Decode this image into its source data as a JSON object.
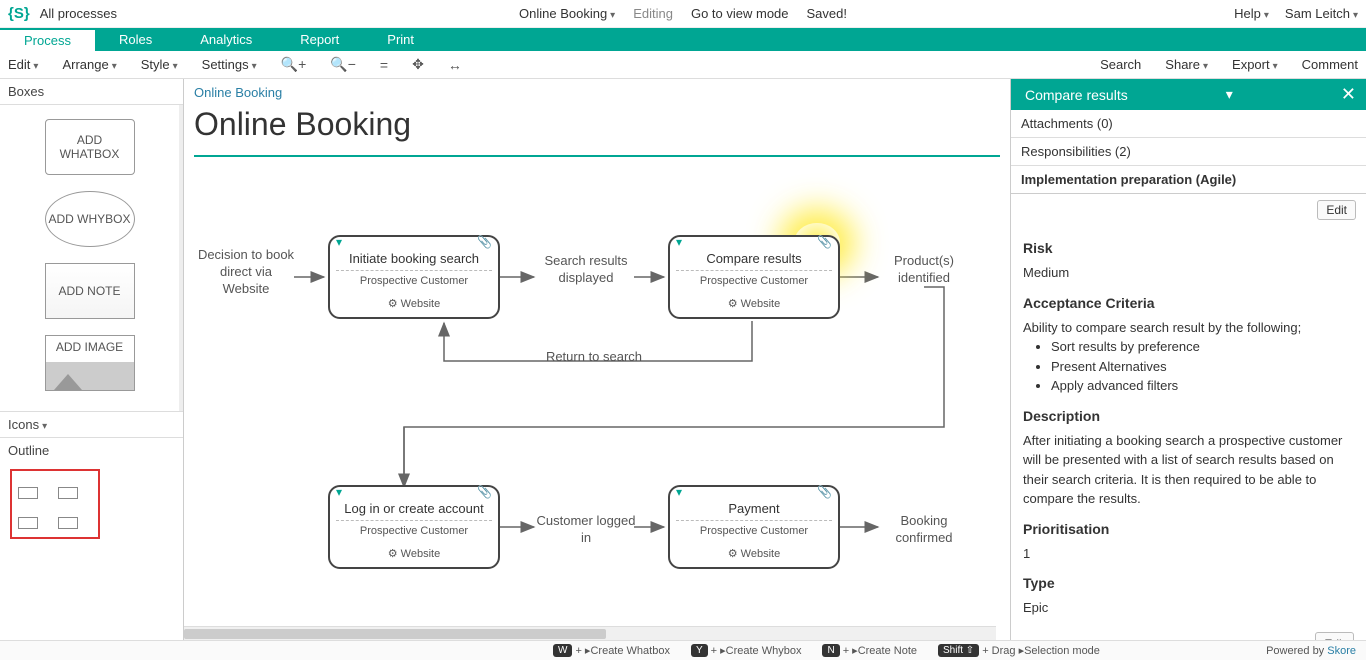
{
  "topbar": {
    "all_processes": "All processes",
    "doc_title": "Online Booking",
    "editing": "Editing",
    "view_mode": "Go to view mode",
    "saved": "Saved!",
    "help": "Help",
    "user": "Sam Leitch"
  },
  "tealnav": {
    "process": "Process",
    "roles": "Roles",
    "analytics": "Analytics",
    "report": "Report",
    "print": "Print"
  },
  "toolbar": {
    "edit": "Edit",
    "arrange": "Arrange",
    "style": "Style",
    "settings": "Settings",
    "search": "Search",
    "share": "Share",
    "export": "Export",
    "comment": "Comment"
  },
  "left": {
    "boxes_head": "Boxes",
    "add_whatbox": "ADD WHATBOX",
    "add_whybox": "ADD WHYBOX",
    "add_note": "ADD NOTE",
    "add_image": "ADD IMAGE",
    "icons_head": "Icons",
    "outline_head": "Outline"
  },
  "canvas": {
    "breadcrumb": "Online Booking",
    "title": "Online Booking",
    "labels": {
      "decision": "Decision to book direct via Website",
      "search_results": "Search results displayed",
      "products_identified": "Product(s) identified",
      "return_to_search": "Return to search",
      "customer_logged_in": "Customer logged in",
      "booking_confirmed": "Booking confirmed"
    },
    "boxes": {
      "b1_title": "Initiate booking search",
      "b2_title": "Compare results",
      "b3_title": "Log in or create account",
      "b4_title": "Payment",
      "role": "Prospective Customer",
      "system": "Website"
    }
  },
  "right": {
    "header": "Compare results",
    "tabs": {
      "attachments": "Attachments (0)",
      "responsibilities": "Responsibilities (2)",
      "implementation": "Implementation preparation (Agile)"
    },
    "edit": "Edit",
    "risk_h": "Risk",
    "risk_v": "Medium",
    "ac_h": "Acceptance Criteria",
    "ac_intro": "Ability to compare search result by the following;",
    "ac_items": [
      "Sort results by preference",
      "Present Alternatives",
      "Apply advanced filters"
    ],
    "desc_h": "Description",
    "desc_v": "After initiating a booking search a prospective customer will be presented with a list of search results based on their search criteria. It is then required to be able to compare the results.",
    "prio_h": "Prioritisation",
    "prio_v": "1",
    "type_h": "Type",
    "type_v": "Epic"
  },
  "bottom": {
    "w": "Create Whatbox",
    "y": "Create Whybox",
    "n": "Create Note",
    "shift": "Selection mode",
    "powered": "Powered by",
    "skore": "Skore"
  }
}
